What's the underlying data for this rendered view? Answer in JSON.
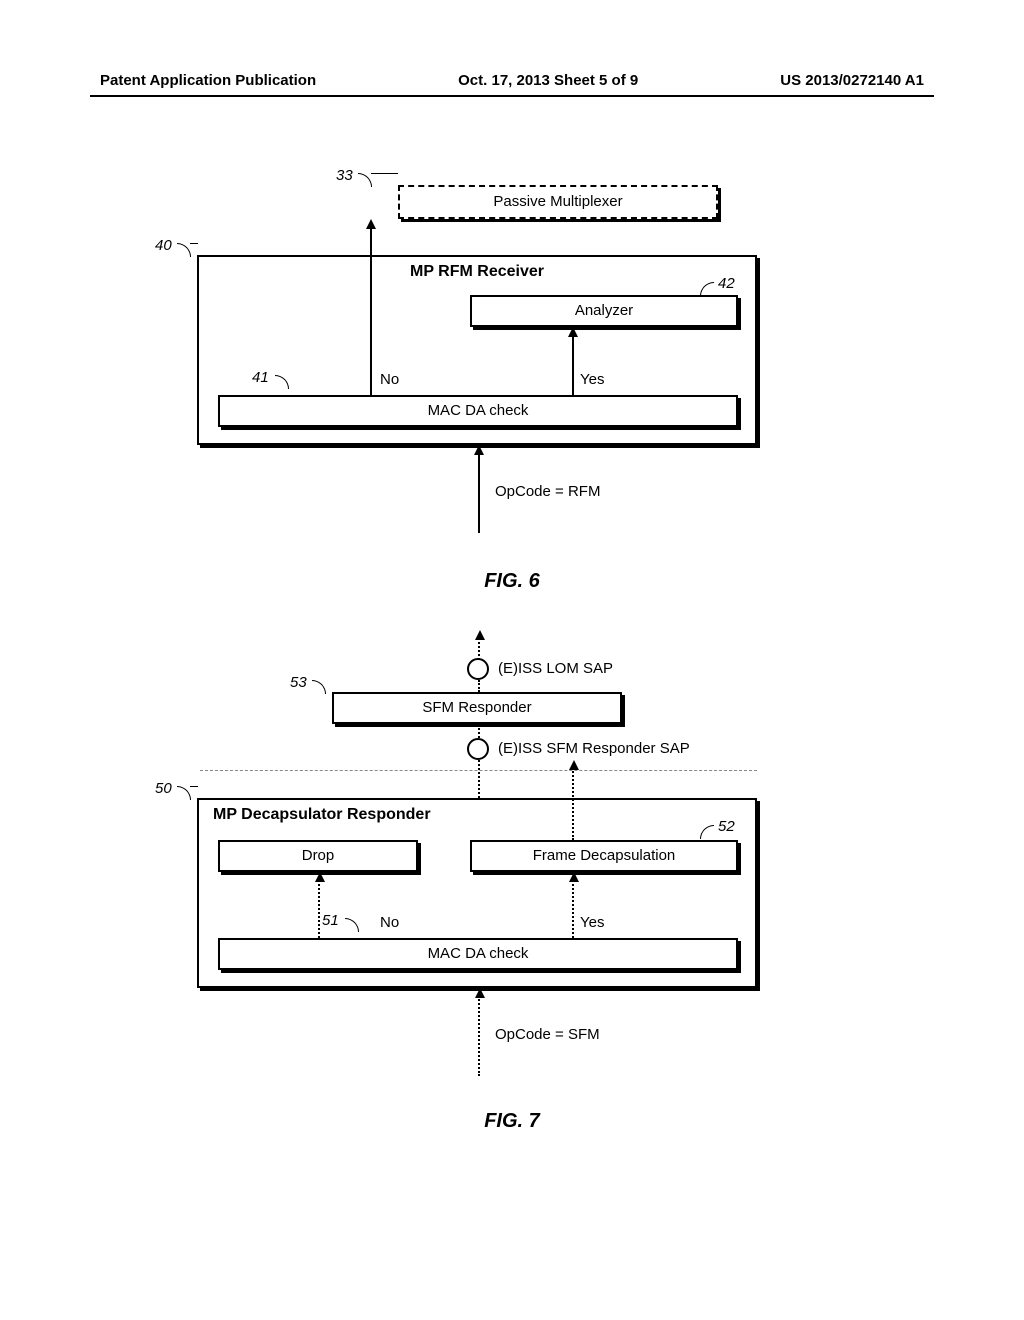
{
  "header": {
    "left": "Patent Application Publication",
    "center": "Oct. 17, 2013  Sheet 5 of 9",
    "right": "US 2013/0272140 A1"
  },
  "fig6": {
    "caption": "FIG. 6",
    "ref33": "33",
    "ref40": "40",
    "ref41": "41",
    "ref42": "42",
    "passive_mux": "Passive Multiplexer",
    "receiver_title": "MP RFM Receiver",
    "analyzer": "Analyzer",
    "mac_check": "MAC DA check",
    "no": "No",
    "yes": "Yes",
    "opcode": "OpCode = RFM"
  },
  "fig7": {
    "caption": "FIG. 7",
    "ref50": "50",
    "ref51": "51",
    "ref52": "52",
    "ref53": "53",
    "lom_sap": "(E)ISS LOM SAP",
    "sfm_responder": "SFM Responder",
    "resp_sap": "(E)ISS SFM Responder SAP",
    "decap_title": "MP Decapsulator Responder",
    "drop": "Drop",
    "frame_decap": "Frame Decapsulation",
    "mac_check": "MAC DA check",
    "no": "No",
    "yes": "Yes",
    "opcode": "OpCode = SFM"
  }
}
